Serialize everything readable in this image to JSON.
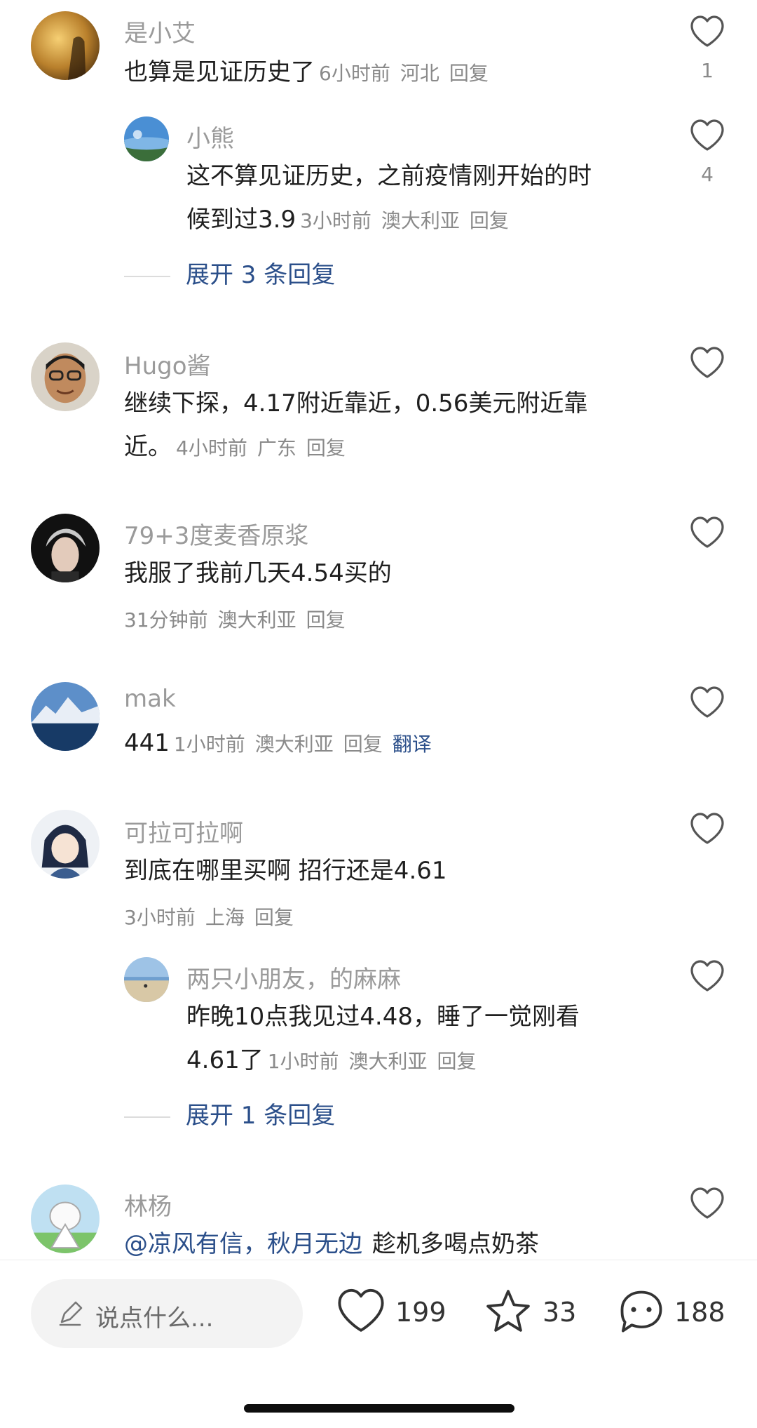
{
  "comments": [
    {
      "name": "是小艾",
      "text": "也算是见证历史了",
      "time": "6小时前",
      "region": "河北",
      "reply": "回复",
      "likes": "1",
      "replies": [
        {
          "name": "小熊",
          "text_line1": "这不算见证历史，之前疫情刚开始的时",
          "text_line2": "候到过3.9",
          "time": "3小时前",
          "region": "澳大利亚",
          "reply": "回复",
          "likes": "4"
        }
      ],
      "expand": "展开 3 条回复"
    },
    {
      "name": "Hugo酱",
      "text_line1": "继续下探，4.17附近靠近，0.56美元附近靠",
      "text_line2": "近。",
      "time": "4小时前",
      "region": "广东",
      "reply": "回复"
    },
    {
      "name": "79+3度麦香原浆",
      "text": "我服了我前几天4.54买的",
      "time": "31分钟前",
      "region": "澳大利亚",
      "reply": "回复"
    },
    {
      "name": "mak",
      "text": "441",
      "time": "1小时前",
      "region": "澳大利亚",
      "reply": "回复",
      "translate": "翻译"
    },
    {
      "name": "可拉可拉啊",
      "text": "到底在哪里买啊 招行还是4.61",
      "time": "3小时前",
      "region": "上海",
      "reply": "回复",
      "replies": [
        {
          "name": "两只小朋友，的麻麻",
          "text_line1": "昨晚10点我见过4.48，睡了一觉刚看",
          "text_line2": "4.61了",
          "time": "1小时前",
          "region": "澳大利亚",
          "reply": "回复"
        }
      ],
      "expand": "展开 1 条回复"
    },
    {
      "name": "林杨",
      "mention": "@凉风有信，秋月无边",
      "text": "趁机多喝点奶茶"
    }
  ],
  "bottom_bar": {
    "placeholder": "说点什么...",
    "likes": "199",
    "favorites": "33",
    "comments": "188",
    "icons": [
      "pen-icon",
      "heart-icon",
      "star-icon",
      "comment-bubble-icon"
    ]
  }
}
